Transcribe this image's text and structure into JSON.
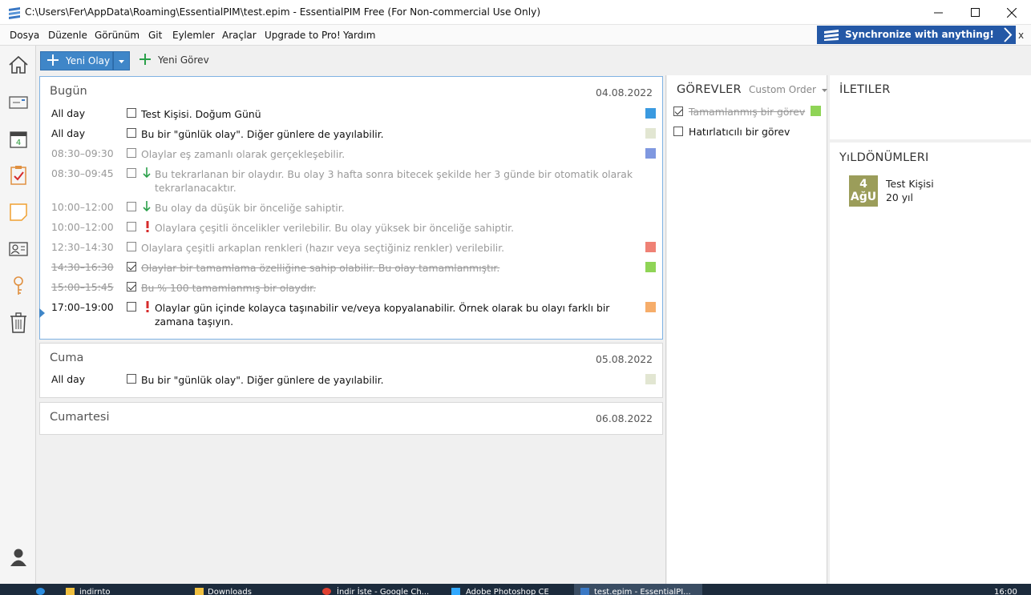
{
  "window": {
    "title": "C:\\Users\\Fer\\AppData\\Roaming\\EssentialPIM\\test.epim - EssentialPIM Free (For Non-commercial Use Only)"
  },
  "menu": {
    "items": [
      "Dosya",
      "Düzenle",
      "Görünüm",
      "Git",
      "Eylemler",
      "Araçlar",
      "Upgrade to Pro!",
      "Yardım"
    ]
  },
  "sync_banner": {
    "label": "Synchronize with anything!",
    "close": "x"
  },
  "toolbar": {
    "new_event": "Yeni Olay",
    "new_task": "Yeni Görev"
  },
  "days": [
    {
      "name": "Bugün",
      "date": "04.08.2022",
      "events": [
        {
          "time": "All day",
          "text": "Test Kişisi. Doğum Günü",
          "color": "#3a9ae0",
          "state": "normal",
          "priority": ""
        },
        {
          "time": "All day",
          "text": "Bu bir \"günlük olay\". Diğer günlere de yayılabilir.",
          "color": "#e2e6d2",
          "state": "normal",
          "priority": ""
        },
        {
          "time": "08:30–09:30",
          "text": "Olaylar eş zamanlı olarak gerçekleşebilir.",
          "color": "#7f98e0",
          "state": "grey",
          "priority": ""
        },
        {
          "time": "08:30–09:45",
          "text": "Bu tekrarlanan bir olaydır. Bu olay 3 hafta sonra bitecek şekilde her 3 günde bir otomatik olarak tekrarlanacaktır.",
          "color": "",
          "state": "grey",
          "priority": "low"
        },
        {
          "time": "10:00–12:00",
          "text": "Bu olay da düşük bir önceliğe sahiptir.",
          "color": "",
          "state": "grey",
          "priority": "low"
        },
        {
          "time": "10:00–12:00",
          "text": "Olaylara çeşitli öncelikler verilebilir. Bu olay yüksek bir önceliğe sahiptir.",
          "color": "",
          "state": "grey",
          "priority": "high"
        },
        {
          "time": "12:30–14:30",
          "text": "Olaylara çeşitli arkaplan renkleri (hazır veya seçtiğiniz renkler) verilebilir.",
          "color": "#ef8175",
          "state": "grey",
          "priority": ""
        },
        {
          "time": "14:30–16:30",
          "text": "Olaylar bir tamamlama özelliğine sahip olabilir. Bu olay tamamlanmıştır.",
          "color": "#8fd456",
          "state": "done",
          "priority": ""
        },
        {
          "time": "15:00–15:45",
          "text": "Bu % 100 tamamlanmış bir olaydır.",
          "color": "",
          "state": "done",
          "priority": ""
        },
        {
          "time": "17:00–19:00",
          "text": "Olaylar gün içinde kolayca taşınabilir ve/veya kopyalanabilir. Örnek olarak bu olayı farklı bir zamana taşıyın.",
          "color": "#f6ad6a",
          "state": "normal",
          "priority": "high"
        }
      ]
    },
    {
      "name": "Cuma",
      "date": "05.08.2022",
      "events": [
        {
          "time": "All day",
          "text": "Bu bir \"günlük olay\". Diğer günlere de yayılabilir.",
          "color": "#e2e6d2",
          "state": "normal",
          "priority": ""
        }
      ]
    },
    {
      "name": "Cumartesi",
      "date": "06.08.2022",
      "events": []
    }
  ],
  "tasks": {
    "heading": "GÖREVLER",
    "sort_label": "Custom Order",
    "items": [
      {
        "text": "Tamamlanmış bir görev",
        "done": true,
        "color": "#8fd456"
      },
      {
        "text": "Hatırlatıcılı bir görev",
        "done": false,
        "color": ""
      }
    ]
  },
  "notes": {
    "heading": "İLETILER"
  },
  "anniversaries": {
    "heading": "YıLDÖNÜMLERI",
    "items": [
      {
        "day": "4",
        "month": "AğU",
        "name": "Test Kişisi",
        "years": "20 yıl"
      }
    ]
  },
  "taskbar": {
    "items": [
      "indirnto",
      "Downloads",
      "İndir İste - Google Ch...",
      "Adobe Photoshop CE",
      "test.epim - EssentialPI..."
    ],
    "clock": "16:00"
  },
  "colors": {
    "accent": "#3f86c8",
    "sync_banner": "#2458a6",
    "anniversary_badge": "#9b9d5a",
    "priority_high": "#d62b2b",
    "priority_low": "#2aa04a"
  }
}
